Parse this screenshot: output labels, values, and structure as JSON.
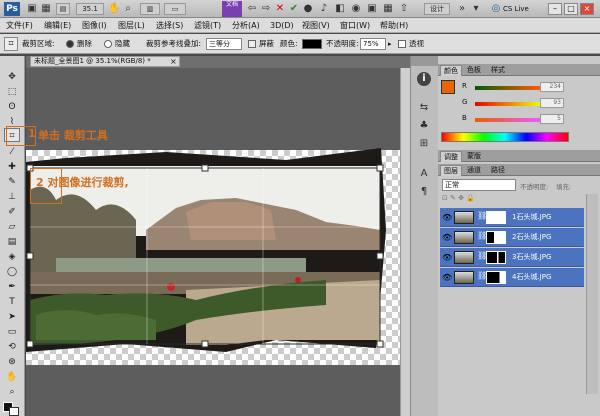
{
  "titlebar": {
    "app_logo": "Ps",
    "zoom": "35.1",
    "mode_badge": "文档",
    "buttons": [
      "设计",
      "CS Live"
    ],
    "window_controls": [
      "–",
      "□",
      "×"
    ]
  },
  "menubar": {
    "items": [
      "文件(F)",
      "编辑(E)",
      "图像(I)",
      "图层(L)",
      "选择(S)",
      "滤镜(T)",
      "分析(A)",
      "3D(D)",
      "视图(V)",
      "窗口(W)",
      "帮助(H)"
    ]
  },
  "options": {
    "crop_area_label": "裁剪区域:",
    "delete_label": "删除",
    "hide_label": "隐藏",
    "overlay_label": "裁剪参考线叠加:",
    "overlay_value": "三等分",
    "shield_label": "屏蔽",
    "color_label": "颜色:",
    "opacity_label": "不透明度:",
    "opacity_value": "75%",
    "perspective_label": "透视"
  },
  "document": {
    "tab_title": "未标题_全景图1 @ 35.1%(RGB/8) *"
  },
  "annotations": {
    "step1_index": "1",
    "step1": "单击 裁剪工具",
    "step2": "2 对图像进行裁剪,"
  },
  "color_panel": {
    "tabs": [
      "颜色",
      "色板",
      "样式"
    ],
    "sliders": [
      {
        "label": "R",
        "value": "234"
      },
      {
        "label": "G",
        "value": "93"
      },
      {
        "label": "B",
        "value": "5"
      }
    ]
  },
  "adjust_panel": {
    "tabs": [
      "调整",
      "蒙版"
    ]
  },
  "layers_panel": {
    "tabs": [
      "图层",
      "通道",
      "路径"
    ],
    "blend_mode": "正常",
    "opacity_label": "不透明度:",
    "fill_label": "填充:",
    "layers": [
      "1石头城.JPG",
      "2石头城.JPG",
      "3石头城.JPG",
      "4石头城.JPG"
    ]
  },
  "colors": {
    "accent_orange": "#e8650a",
    "layer_selected": "#4b73bf",
    "annotation": "#d07020"
  }
}
